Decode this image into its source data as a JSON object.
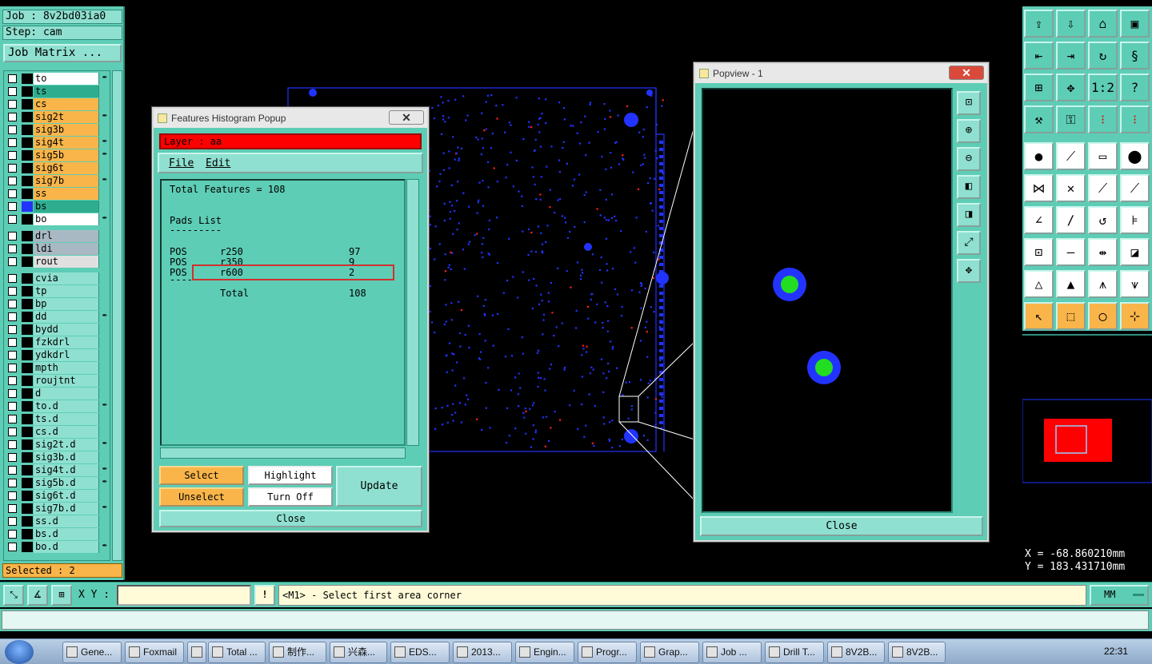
{
  "left_panel": {
    "job": "Job : 8v2bd03ia0",
    "step": "Step: cam",
    "job_matrix": "Job Matrix ...",
    "layers": [
      {
        "name": "to",
        "color": "#ffffff",
        "mark": "✒"
      },
      {
        "name": "ts",
        "color": "#2fae8f",
        "mark": ""
      },
      {
        "name": "cs",
        "color": "#f9b54a",
        "mark": ""
      },
      {
        "name": "sig2t",
        "color": "#f9b54a",
        "mark": "✒"
      },
      {
        "name": "sig3b",
        "color": "#f9b54a",
        "mark": ""
      },
      {
        "name": "sig4t",
        "color": "#f9b54a",
        "mark": "✒"
      },
      {
        "name": "sig5b",
        "color": "#f9b54a",
        "mark": "✒"
      },
      {
        "name": "sig6t",
        "color": "#f9b54a",
        "mark": ""
      },
      {
        "name": "sig7b",
        "color": "#f9b54a",
        "mark": "✒"
      },
      {
        "name": "ss",
        "color": "#f9b54a",
        "mark": ""
      },
      {
        "name": "bs",
        "color": "#2fae8f",
        "mark": ""
      },
      {
        "name": "bo",
        "color": "#ffffff",
        "mark": "✒"
      },
      {
        "name": "drl",
        "color": "#a9b9c3",
        "mark": ""
      },
      {
        "name": "ldi",
        "color": "#a9b9c3",
        "mark": ""
      },
      {
        "name": "rout",
        "color": "#e0e0e0",
        "mark": ""
      },
      {
        "name": "cvia",
        "color": "#8fe0d0",
        "mark": ""
      },
      {
        "name": "tp",
        "color": "#8fe0d0",
        "mark": ""
      },
      {
        "name": "bp",
        "color": "#8fe0d0",
        "mark": ""
      },
      {
        "name": "dd",
        "color": "#8fe0d0",
        "mark": "✒"
      },
      {
        "name": "bydd",
        "color": "#8fe0d0",
        "mark": ""
      },
      {
        "name": "fzkdrl",
        "color": "#8fe0d0",
        "mark": ""
      },
      {
        "name": "ydkdrl",
        "color": "#8fe0d0",
        "mark": ""
      },
      {
        "name": "mpth",
        "color": "#8fe0d0",
        "mark": ""
      },
      {
        "name": "roujtnt",
        "color": "#8fe0d0",
        "mark": ""
      },
      {
        "name": "d",
        "color": "#8fe0d0",
        "mark": ""
      },
      {
        "name": "to.d",
        "color": "#8fe0d0",
        "mark": "✒"
      },
      {
        "name": "ts.d",
        "color": "#8fe0d0",
        "mark": ""
      },
      {
        "name": "cs.d",
        "color": "#8fe0d0",
        "mark": ""
      },
      {
        "name": "sig2t.d",
        "color": "#8fe0d0",
        "mark": "✒"
      },
      {
        "name": "sig3b.d",
        "color": "#8fe0d0",
        "mark": ""
      },
      {
        "name": "sig4t.d",
        "color": "#8fe0d0",
        "mark": "✒"
      },
      {
        "name": "sig5b.d",
        "color": "#8fe0d0",
        "mark": "✒"
      },
      {
        "name": "sig6t.d",
        "color": "#8fe0d0",
        "mark": ""
      },
      {
        "name": "sig7b.d",
        "color": "#8fe0d0",
        "mark": "✒"
      },
      {
        "name": "ss.d",
        "color": "#8fe0d0",
        "mark": ""
      },
      {
        "name": "bs.d",
        "color": "#8fe0d0",
        "mark": ""
      },
      {
        "name": "bo.d",
        "color": "#8fe0d0",
        "mark": "✒"
      }
    ],
    "selected": "Selected : 2"
  },
  "histogram": {
    "title": "Features Histogram Popup",
    "layer": "Layer :  aa",
    "menu": [
      "File",
      "Edit"
    ],
    "total_features": "Total Features = 108",
    "section": "Pads List",
    "rule": "---------",
    "rows": [
      {
        "type": "POS",
        "symbol": "r250",
        "count": "97"
      },
      {
        "type": "POS",
        "symbol": "r350",
        "count": "9"
      },
      {
        "type": "POS",
        "symbol": "r600",
        "count": "2"
      }
    ],
    "total_label": "Total",
    "total_value": "108",
    "buttons": {
      "select": "Select",
      "highlight": "Highlight",
      "unselect": "Unselect",
      "turn_off": "Turn Off",
      "update": "Update",
      "close": "Close"
    }
  },
  "popview": {
    "title": "Popview - 1",
    "close": "Close"
  },
  "coords": {
    "x": "X = -68.860210mm",
    "y": "Y = 183.431710mm"
  },
  "status": {
    "xy_label": "X Y :",
    "message": "<M1> - Select first area corner",
    "units": "MM"
  },
  "taskbar": {
    "items": [
      "Gene...",
      "Foxmail",
      "",
      "Total ...",
      "制作...",
      "兴森...",
      "EDS...",
      "2013...",
      "Engin...",
      "Progr...",
      "Grap...",
      "Job ...",
      "Drill T...",
      "8V2B...",
      "8V2B..."
    ],
    "clock": "22:31"
  },
  "colors": {
    "teal": "#5ecdb5",
    "orange": "#f9b54a",
    "blue": "#1f1fff",
    "red": "#ff0000",
    "green": "#22dd22"
  }
}
